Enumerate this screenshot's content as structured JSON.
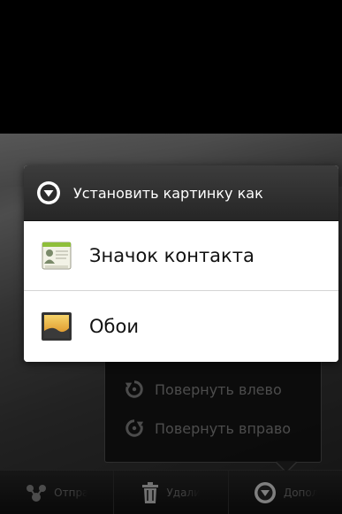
{
  "dialog": {
    "title": "Установить картинку как",
    "items": [
      {
        "label": "Значок контакта",
        "icon": "contact-card-icon"
      },
      {
        "label": "Обои",
        "icon": "wallpaper-icon"
      }
    ]
  },
  "more_menu": {
    "items": [
      {
        "label": "Повернуть влево",
        "icon": "rotate-left-icon"
      },
      {
        "label": "Повернуть вправо",
        "icon": "rotate-right-icon"
      }
    ]
  },
  "action_bar": {
    "share_label": "Отправить",
    "delete_label": "Удалить",
    "more_label": "Дополнительно"
  },
  "colors": {
    "accent": "#ffffff",
    "dialog_header": "#2f2f2f",
    "dialog_body": "#ffffff"
  }
}
